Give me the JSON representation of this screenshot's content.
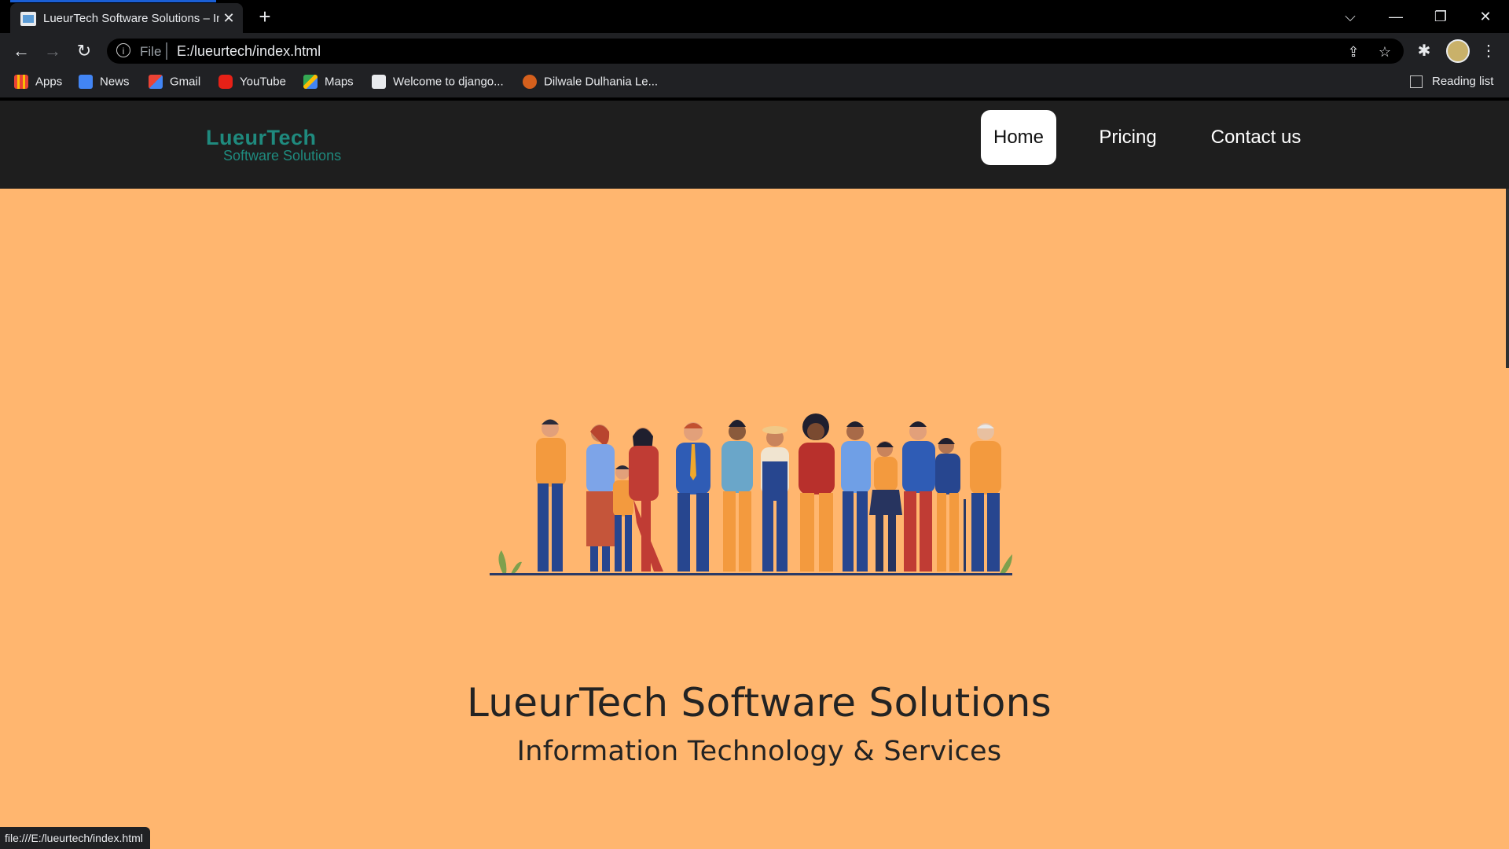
{
  "browser": {
    "tab_title": "LueurTech Software Solutions – Infor",
    "tab_close": "✕",
    "new_tab": "+",
    "address": {
      "scheme_label": "File",
      "url": "E:/lueurtech/index.html"
    },
    "bookmarks": [
      {
        "label": "Apps",
        "icon": "apps-grid-icon"
      },
      {
        "label": "News",
        "icon": "google-news-icon"
      },
      {
        "label": "Gmail",
        "icon": "gmail-icon"
      },
      {
        "label": "YouTube",
        "icon": "youtube-icon"
      },
      {
        "label": "Maps",
        "icon": "maps-icon"
      },
      {
        "label": "Welcome to django...",
        "icon": "django-page-icon"
      },
      {
        "label": "Dilwale Dulhania Le...",
        "icon": "movie-page-icon"
      }
    ],
    "reading_list": "Reading list",
    "status_url": "file:///E:/lueurtech/index.html"
  },
  "site": {
    "logo": {
      "main": "LueurTech",
      "sub": "Software Solutions"
    },
    "nav": [
      {
        "label": "Home",
        "active": true
      },
      {
        "label": "Pricing",
        "active": false
      },
      {
        "label": "Contact us",
        "active": false
      }
    ],
    "hero": {
      "image": "people-group-illustration",
      "title": "LueurTech Software Solutions",
      "subtitle": "Information Technology & Services"
    }
  },
  "colors": {
    "hero_bg": "#ffb66f",
    "nav_bg": "#1e1e1e",
    "logo": "#1f8a7e",
    "text_dark": "#232323"
  }
}
